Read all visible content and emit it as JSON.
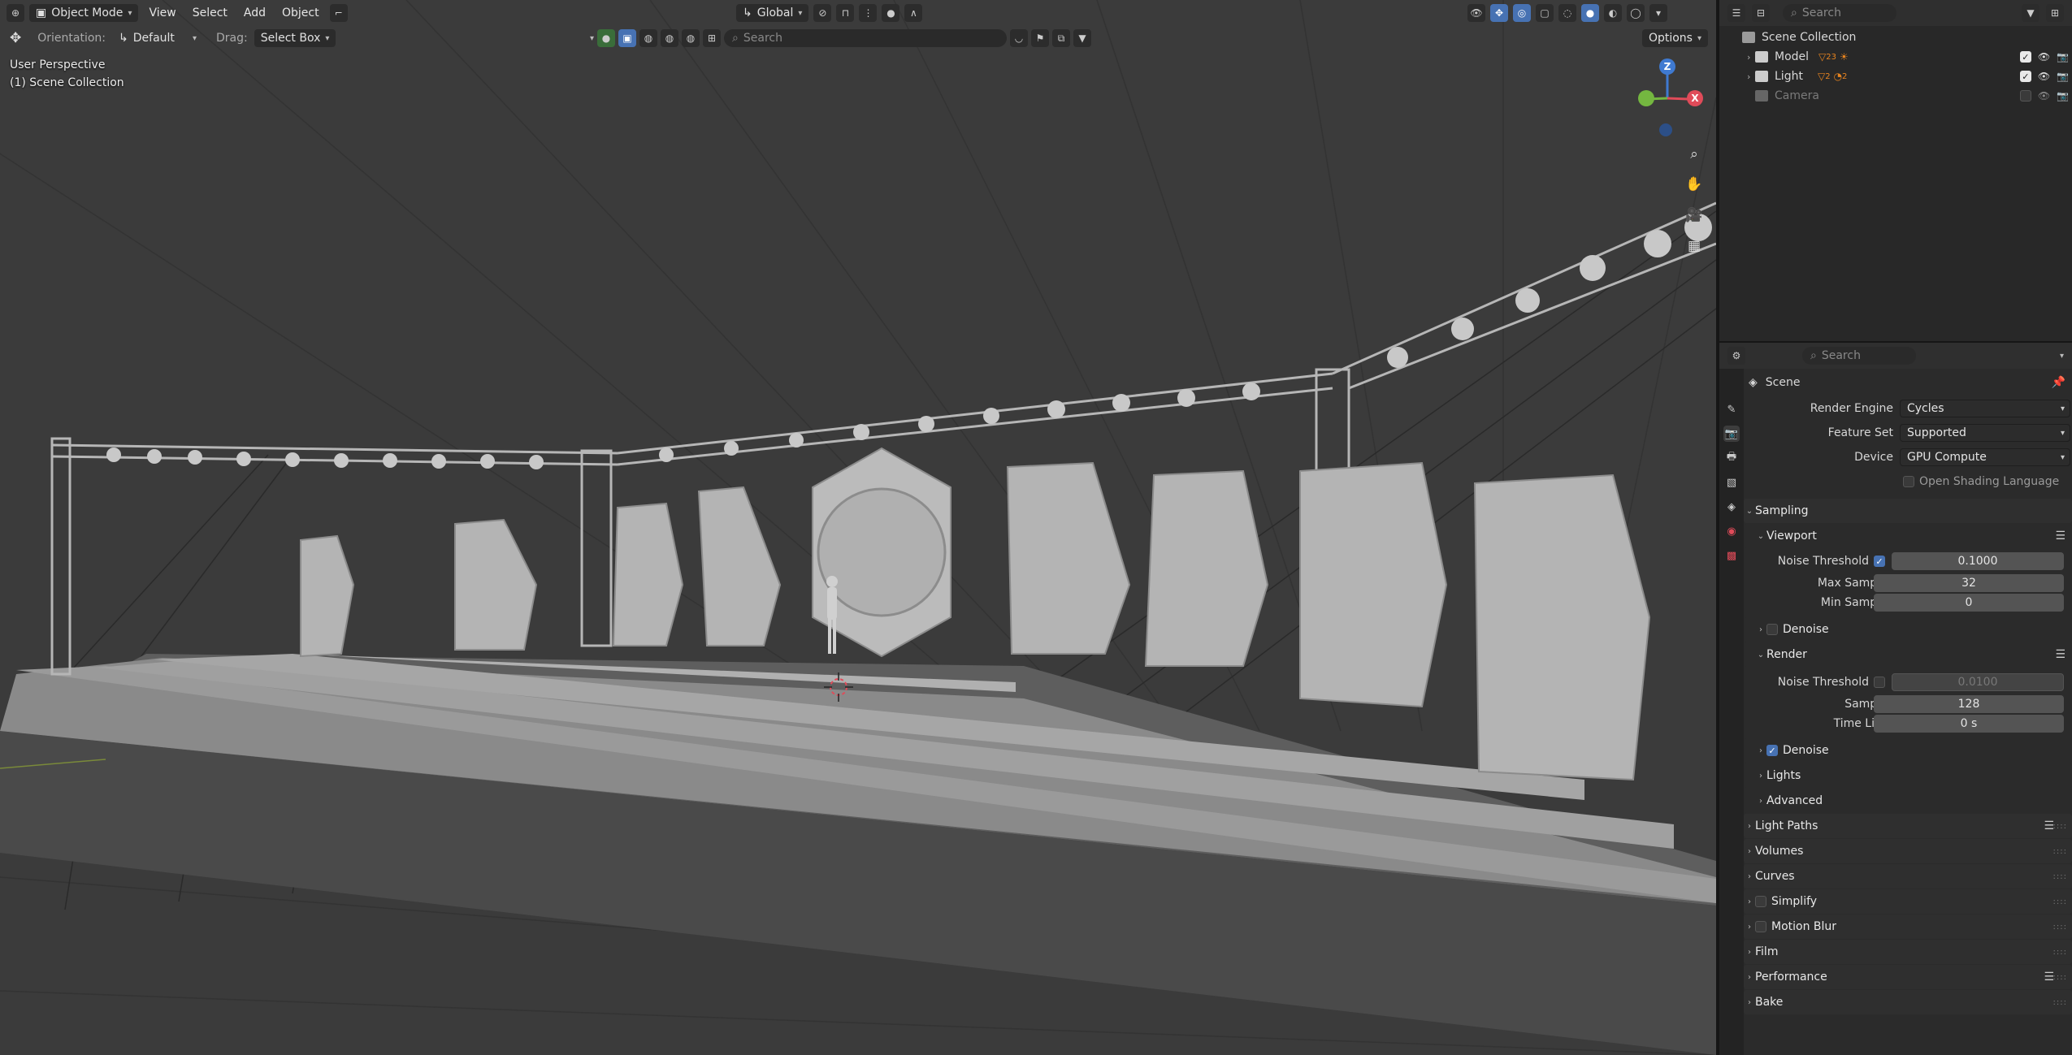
{
  "viewport_header": {
    "mode": "Object Mode",
    "menus": [
      "View",
      "Select",
      "Add",
      "Object"
    ],
    "transform_orientation": "Global",
    "orientation_label": "Orientation:",
    "orientation_value": "Default",
    "drag_label": "Drag:",
    "drag_value": "Select Box",
    "search_placeholder": "Search",
    "options_label": "Options"
  },
  "viewport_overlay": {
    "perspective": "User Perspective",
    "collection": "(1) Scene Collection"
  },
  "gizmo": {
    "x": "X",
    "y": "Y",
    "z": "Z"
  },
  "outliner": {
    "search_placeholder": "Search",
    "root": "Scene Collection",
    "items": [
      {
        "label": "Model",
        "badge1": "23",
        "visible": true,
        "enabled": true
      },
      {
        "label": "Light",
        "badge1": "2",
        "badge2": "2",
        "visible": true,
        "enabled": true
      },
      {
        "label": "Camera",
        "visible": true,
        "enabled": false
      }
    ]
  },
  "properties": {
    "search_placeholder": "Search",
    "context": "Scene",
    "render_engine_label": "Render Engine",
    "render_engine_value": "Cycles",
    "feature_set_label": "Feature Set",
    "feature_set_value": "Supported",
    "device_label": "Device",
    "device_value": "GPU Compute",
    "open_shading_language": "Open Shading Language",
    "sampling": "Sampling",
    "viewport": "Viewport",
    "vp_noise_threshold_label": "Noise Threshold",
    "vp_noise_threshold_value": "0.1000",
    "vp_max_samples_label": "Max Samples",
    "vp_max_samples_value": "32",
    "vp_min_samples_label": "Min Samples",
    "vp_min_samples_value": "0",
    "vp_denoise": "Denoise",
    "render": "Render",
    "r_noise_threshold_label": "Noise Threshold",
    "r_noise_threshold_value": "0.0100",
    "r_samples_label": "Samples",
    "r_samples_value": "128",
    "r_time_limit_label": "Time Limit",
    "r_time_limit_value": "0 s",
    "r_denoise": "Denoise",
    "lights": "Lights",
    "advanced": "Advanced",
    "panels": [
      "Light Paths",
      "Volumes",
      "Curves",
      "Simplify",
      "Motion Blur",
      "Film",
      "Performance",
      "Bake"
    ]
  },
  "colors": {
    "accent_blue": "#4772b3",
    "axis_x": "#e04b59",
    "axis_y": "#74b740",
    "axis_z": "#3f7ad1",
    "light_orange": "#e8841f"
  }
}
